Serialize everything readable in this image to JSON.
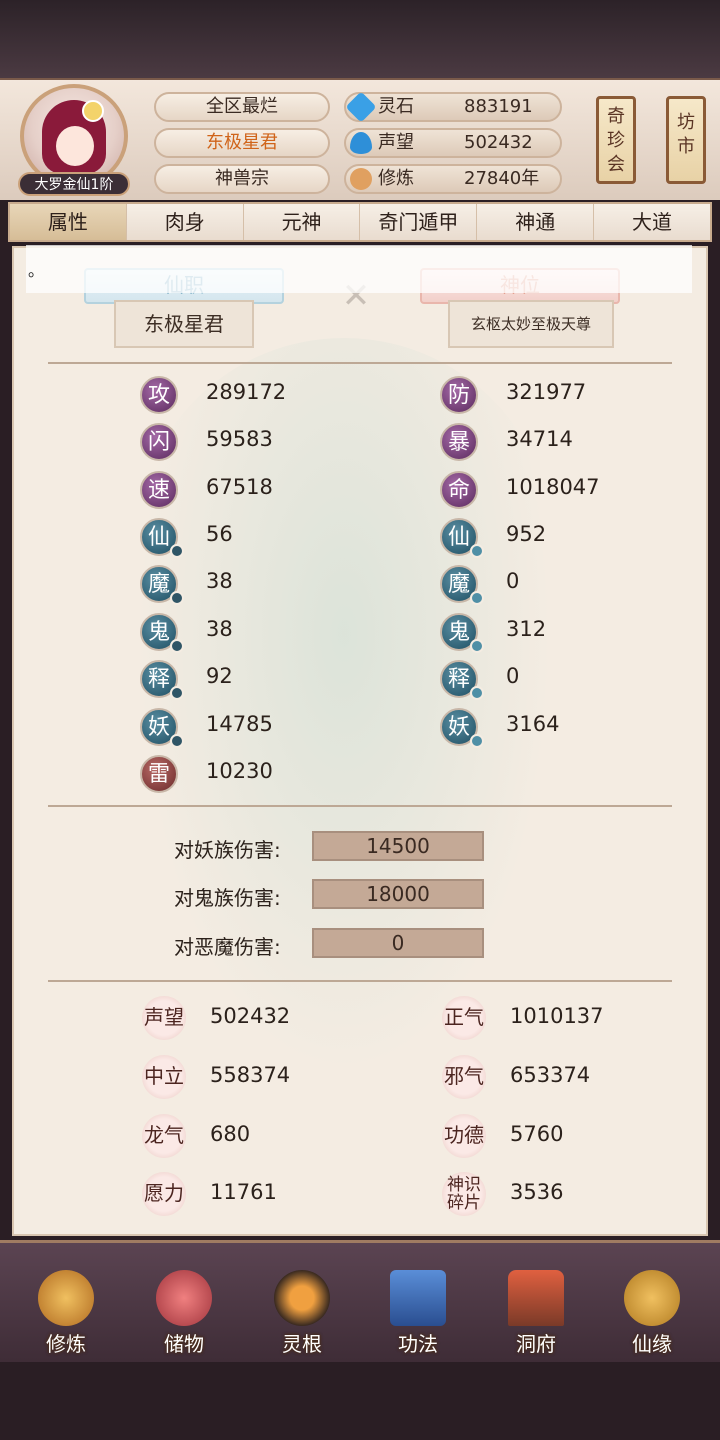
{
  "profile": {
    "rank": "大罗金仙1阶"
  },
  "titles": [
    "全区最烂",
    "东极星君",
    "神兽宗"
  ],
  "resources": [
    {
      "label": "灵石",
      "value": "883191",
      "icon": "spirit-stone-icon",
      "color": "#3aa0e6"
    },
    {
      "label": "声望",
      "value": "502432",
      "icon": "prestige-crystal-icon",
      "color": "#2e8fd8"
    },
    {
      "label": "修炼",
      "value": "27840年",
      "icon": "meditation-icon",
      "color": "#e0a060"
    }
  ],
  "side_buttons": [
    "奇珍会",
    "坊市"
  ],
  "tabs": [
    "属性",
    "肉身",
    "元神",
    "奇门遁甲",
    "神通",
    "大道"
  ],
  "notice": "。",
  "positions": {
    "immortal_label": "仙职",
    "immortal_value": "东极星君",
    "divine_label": "神位",
    "divine_value": "玄枢太妙至极天尊"
  },
  "stats_left": [
    {
      "char": "攻",
      "value": "289172"
    },
    {
      "char": "闪",
      "value": "59583"
    },
    {
      "char": "速",
      "value": "67518"
    },
    {
      "char": "仙",
      "value": "56"
    },
    {
      "char": "魔",
      "value": "38"
    },
    {
      "char": "鬼",
      "value": "38"
    },
    {
      "char": "释",
      "value": "92"
    },
    {
      "char": "妖",
      "value": "14785"
    },
    {
      "char": "雷",
      "value": "10230"
    }
  ],
  "stats_right": [
    {
      "char": "防",
      "value": "321977"
    },
    {
      "char": "暴",
      "value": "34714"
    },
    {
      "char": "命",
      "value": "1018047"
    },
    {
      "char": "仙",
      "value": "952"
    },
    {
      "char": "魔",
      "value": "0"
    },
    {
      "char": "鬼",
      "value": "312"
    },
    {
      "char": "释",
      "value": "0"
    },
    {
      "char": "妖",
      "value": "3164"
    }
  ],
  "damage": [
    {
      "label": "对妖族伤害:",
      "value": "14500"
    },
    {
      "label": "对鬼族伤害:",
      "value": "18000"
    },
    {
      "label": "对恶魔伤害:",
      "value": "0"
    }
  ],
  "reputation_left": [
    {
      "label": "声望",
      "value": "502432"
    },
    {
      "label": "中立",
      "value": "558374"
    },
    {
      "label": "龙气",
      "value": "680"
    },
    {
      "label": "愿力",
      "value": "11761"
    }
  ],
  "reputation_right": [
    {
      "label": "正气",
      "value": "1010137"
    },
    {
      "label": "邪气",
      "value": "653374"
    },
    {
      "label": "功德",
      "value": "5760"
    },
    {
      "label": "神识碎片",
      "value": "3536"
    }
  ],
  "nav": [
    {
      "label": "修炼",
      "icon": "monk-icon"
    },
    {
      "label": "储物",
      "icon": "storage-bag-icon"
    },
    {
      "label": "灵根",
      "icon": "spirit-root-icon"
    },
    {
      "label": "功法",
      "icon": "scripture-book-icon"
    },
    {
      "label": "洞府",
      "icon": "cave-house-icon"
    },
    {
      "label": "仙缘",
      "icon": "gourd-icon"
    }
  ]
}
